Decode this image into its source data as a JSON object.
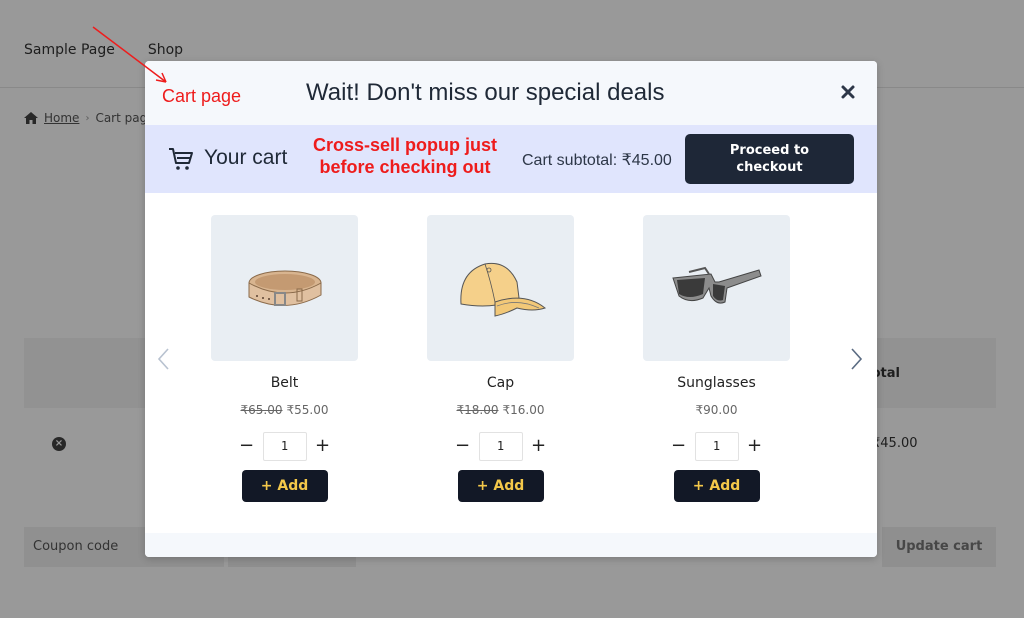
{
  "site": {
    "nav": [
      "Sample Page",
      "Shop"
    ],
    "breadcrumb": {
      "home": "Home",
      "current": "Cart page"
    },
    "cart_table": {
      "total_header": "Total",
      "row_total": "₹45.00"
    },
    "coupon_placeholder": "Coupon code",
    "update_cart_label": "Update cart"
  },
  "modal": {
    "title": "Wait! Don't miss our special deals",
    "close_icon": "close-icon",
    "cart_bar": {
      "icon": "cart-icon",
      "label": "Your cart",
      "subtotal": "Cart subtotal: ₹45.00",
      "checkout_label": "Proceed to checkout"
    },
    "products": [
      {
        "name": "Belt",
        "old_price": "₹65.00",
        "price": "₹55.00",
        "qty": "1",
        "add_label": "+ Add",
        "image": "belt"
      },
      {
        "name": "Cap",
        "old_price": "₹18.00",
        "price": "₹16.00",
        "qty": "1",
        "add_label": "+ Add",
        "image": "cap"
      },
      {
        "name": "Sunglasses",
        "old_price": "",
        "price": "₹90.00",
        "qty": "1",
        "add_label": "+ Add",
        "image": "sunglasses"
      }
    ],
    "qty_minus": "−",
    "qty_plus": "+"
  },
  "annotations": {
    "cart_page": "Cart page",
    "cross_sell": "Cross-sell popup just before checking out",
    "color": "#ee1c1c"
  },
  "colors": {
    "checkout_bg": "#1e2737",
    "add_bg": "#121826",
    "add_text": "#f4c84a",
    "cart_bar_bg": "#e0e5fd"
  }
}
